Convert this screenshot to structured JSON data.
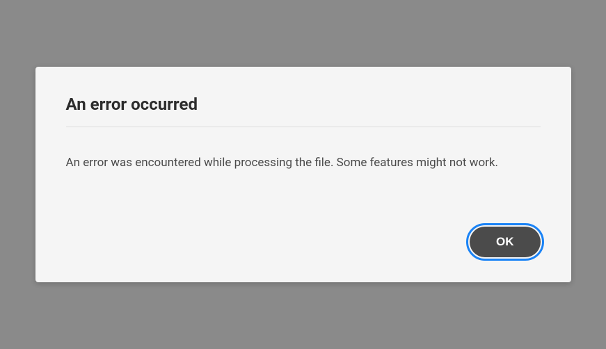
{
  "dialog": {
    "title": "An error occurred",
    "message": "An error was encountered while processing the file. Some features might not work.",
    "ok_label": "OK"
  }
}
